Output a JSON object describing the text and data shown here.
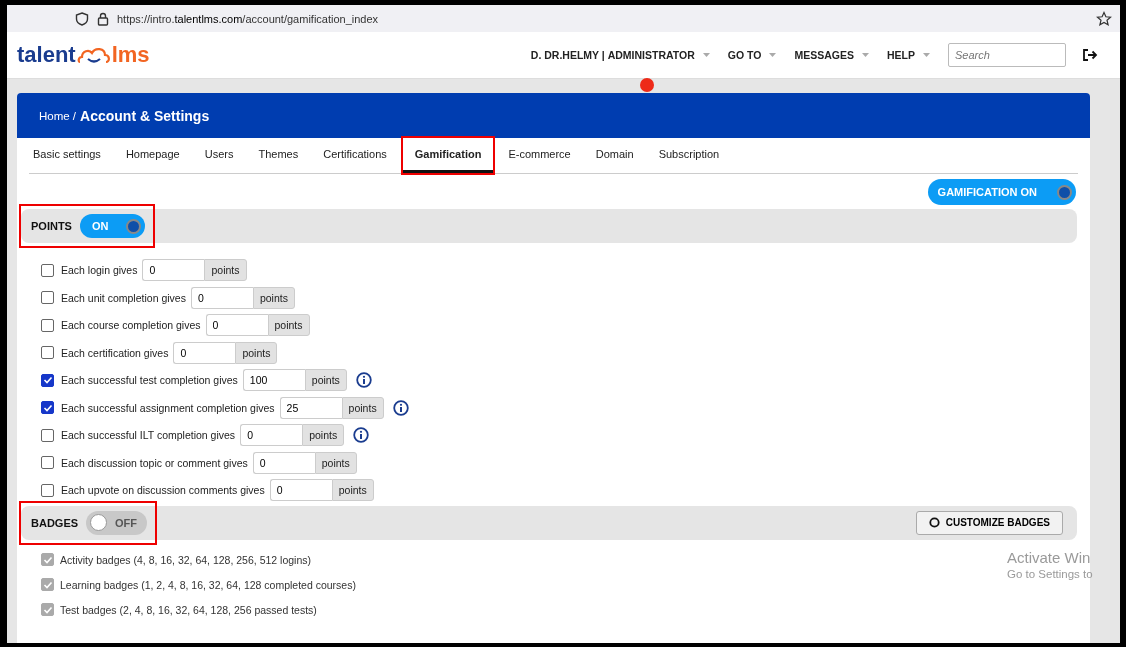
{
  "browser": {
    "url_prefix": "https://intro.",
    "url_domain": "talentlms.com",
    "url_path": "/account/gamification_index"
  },
  "header": {
    "logo_left": "talent",
    "logo_right": "lms",
    "user": "D. DR.HELMY",
    "user_separator": "|",
    "role": "ADMINISTRATOR",
    "menu": [
      "GO TO",
      "MESSAGES",
      "HELP"
    ],
    "search": {
      "placeholder": "Search"
    }
  },
  "breadcrumb": {
    "home": "Home",
    "separator": "/",
    "current": "Account & Settings"
  },
  "tabs": [
    {
      "label": "Basic settings",
      "selected": false,
      "highlighted": false
    },
    {
      "label": "Homepage",
      "selected": false,
      "highlighted": false
    },
    {
      "label": "Users",
      "selected": false,
      "highlighted": false
    },
    {
      "label": "Themes",
      "selected": false,
      "highlighted": false
    },
    {
      "label": "Certifications",
      "selected": false,
      "highlighted": false
    },
    {
      "label": "Gamification",
      "selected": true,
      "highlighted": true
    },
    {
      "label": "E-commerce",
      "selected": false,
      "highlighted": false
    },
    {
      "label": "Domain",
      "selected": false,
      "highlighted": false
    },
    {
      "label": "Subscription",
      "selected": false,
      "highlighted": false
    }
  ],
  "gamification_toggle": {
    "label": "GAMIFICATION ON",
    "on": true
  },
  "points": {
    "title": "POINTS",
    "toggle": {
      "label": "ON",
      "on": true
    },
    "highlighted": true,
    "rules": [
      {
        "label": "Each login gives",
        "checked": false,
        "value": "0",
        "unit": "points",
        "info": false
      },
      {
        "label": "Each unit completion gives",
        "checked": false,
        "value": "0",
        "unit": "points",
        "info": false
      },
      {
        "label": "Each course completion gives",
        "checked": false,
        "value": "0",
        "unit": "points",
        "info": false
      },
      {
        "label": "Each certification gives",
        "checked": false,
        "value": "0",
        "unit": "points",
        "info": false
      },
      {
        "label": "Each successful test completion gives",
        "checked": true,
        "value": "100",
        "unit": "points",
        "info": true
      },
      {
        "label": "Each successful assignment completion gives",
        "checked": true,
        "value": "25",
        "unit": "points",
        "info": true
      },
      {
        "label": "Each successful ILT completion gives",
        "checked": false,
        "value": "0",
        "unit": "points",
        "info": true
      },
      {
        "label": "Each discussion topic or comment gives",
        "checked": false,
        "value": "0",
        "unit": "points",
        "info": false
      },
      {
        "label": "Each upvote on discussion comments gives",
        "checked": false,
        "value": "0",
        "unit": "points",
        "info": false
      }
    ]
  },
  "badges": {
    "title": "BADGES",
    "toggle": {
      "label": "OFF",
      "on": false
    },
    "highlighted": true,
    "customize_button": "CUSTOMIZE BADGES",
    "items": [
      {
        "label": "Activity badges (4, 8, 16, 32, 64, 128, 256, 512 logins)",
        "checked": true,
        "disabled": true
      },
      {
        "label": "Learning badges (1, 2, 4, 8, 16, 32, 64, 128 completed courses)",
        "checked": true,
        "disabled": true
      },
      {
        "label": "Test badges (2, 4, 8, 16, 32, 64, 128, 256 passed tests)",
        "checked": true,
        "disabled": true
      }
    ]
  },
  "os_notice": {
    "title": "Activate Win",
    "subtitle": "Go to Settings to"
  }
}
